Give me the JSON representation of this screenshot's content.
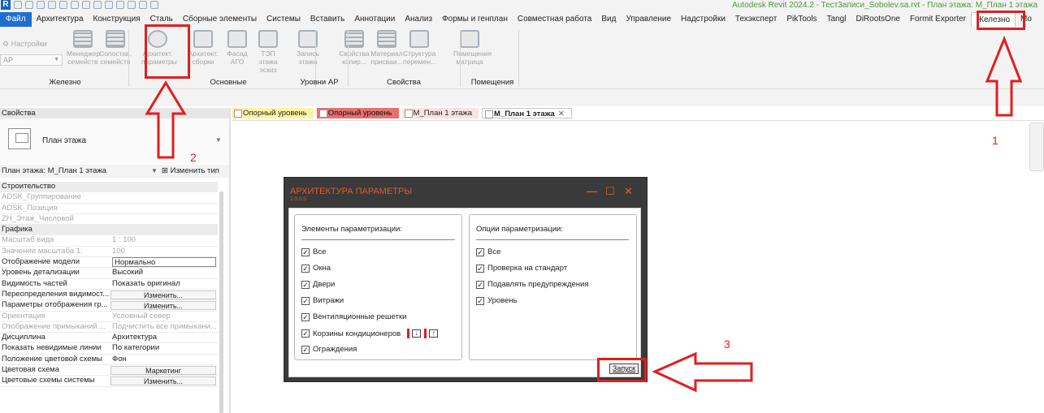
{
  "window": {
    "title": "Autodesk Revit 2024.2 - Тест3аписи_Sobolev.sa.rvt - План этажа: М_План 1 этажа",
    "logo": "R"
  },
  "menu": {
    "file": "Файл",
    "items": [
      "Архитектура",
      "Конструкция",
      "Сталь",
      "Сборные элементы",
      "Системы",
      "Вставить",
      "Аннотации",
      "Анализ",
      "Формы и генплан",
      "Совместная работа",
      "Вид",
      "Управление",
      "Надстройки",
      "Техэксперт",
      "PikTools",
      "Tangl",
      "DiRootsOne",
      "Formit Exporter"
    ],
    "active": "Железно",
    "overflow": "Mo"
  },
  "ribbon": {
    "settings_label": "Настройки",
    "combo_value": "АР",
    "buttons": [
      {
        "l1": "Менеджер",
        "l2": "семейств"
      },
      {
        "l1": "Сопостав.",
        "l2": "семейств"
      },
      {
        "l1": "Архитект.",
        "l2": "параметры"
      },
      {
        "l1": "Архитект.",
        "l2": "сборки"
      },
      {
        "l1": "Фасад",
        "l2": "АГО"
      },
      {
        "l1": "ТЭП этажа",
        "l2": "эскиз"
      },
      {
        "l1": "Запись",
        "l2": "этажа"
      },
      {
        "l1": "Свойства",
        "l2": "копир..."
      },
      {
        "l1": "Материал",
        "l2": "присваи..."
      },
      {
        "l1": "Структура",
        "l2": "перемен..."
      },
      {
        "l1": "Помещения",
        "l2": "матрица"
      }
    ],
    "panels": [
      "Железно",
      "Основные",
      "Уровни АР",
      "Свойства",
      "Помещения"
    ]
  },
  "properties": {
    "header": "Свойства",
    "type_name": "План этажа",
    "instance_label": "План этажа: М_План 1 этажа",
    "edit_type": "Изменить тип",
    "rows": [
      {
        "kind": "cat",
        "name": "Строительство"
      },
      {
        "kind": "row",
        "name": "ADSK_Группирование",
        "value": "",
        "gray": true
      },
      {
        "kind": "row",
        "name": "ADSK_Позиция",
        "value": "",
        "gray": true
      },
      {
        "kind": "row",
        "name": "ZH_Этаж_Числовой",
        "value": "",
        "gray": true
      },
      {
        "kind": "cat",
        "name": "Графика"
      },
      {
        "kind": "row",
        "name": "Масштаб вида",
        "value": "1 : 100",
        "gray": true
      },
      {
        "kind": "row",
        "name": "Значение масштаба    1:",
        "value": "100",
        "gray": true
      },
      {
        "kind": "box",
        "name": "Отображение модели",
        "value": "Нормально"
      },
      {
        "kind": "row",
        "name": "Уровень детализации",
        "value": "Высокий"
      },
      {
        "kind": "row",
        "name": "Видимость частей",
        "value": "Показать оригинал"
      },
      {
        "kind": "btn",
        "name": "Переопределения видимост...",
        "value": "Изменить..."
      },
      {
        "kind": "btn",
        "name": "Параметры отображения гр...",
        "value": "Изменить..."
      },
      {
        "kind": "row",
        "name": "Ориентация",
        "value": "Условный север",
        "gray": true
      },
      {
        "kind": "row",
        "name": "Отображение примыканий ...",
        "value": "Подчистить все примыкани...",
        "gray": true
      },
      {
        "kind": "row",
        "name": "Дисциплина",
        "value": "Архитектура"
      },
      {
        "kind": "row",
        "name": "Показать невидимые линии",
        "value": "По категории"
      },
      {
        "kind": "row",
        "name": "Положение цветовой схемы",
        "value": "Фон"
      },
      {
        "kind": "btn",
        "name": "Цветовая схема",
        "value": "Маркетинг"
      },
      {
        "kind": "btn",
        "name": "Цветовые схемы системы",
        "value": "Изменить..."
      }
    ]
  },
  "tabs": [
    {
      "label": "Опорный уровень"
    },
    {
      "label": "Опорный уровень"
    },
    {
      "label": "М_План 1 этажа"
    },
    {
      "label": "М_План 1 этажа",
      "close": "✕"
    }
  ],
  "dialog": {
    "title": "АРХИТЕКТУРА ПАРАМЕТРЫ",
    "version": "1.0.0.5",
    "controls": {
      "minimize": "—",
      "maximize": "☐",
      "close": "✕"
    },
    "left": {
      "title": "Элементы параметризации:",
      "items": [
        "Все",
        "Окна",
        "Двери",
        "Витражи",
        "Вентиляционные решетки",
        "Корзины кондиционеров",
        "Ограждения"
      ]
    },
    "right": {
      "title": "Опции параметризации:",
      "items": [
        "Все",
        "Проверка на стандарт",
        "Подавлять предупреждения",
        "Уровень"
      ]
    },
    "run": "Запуск",
    "check_mark": "✓"
  },
  "annotations": {
    "n1": "1",
    "n2": "2",
    "n3": "3",
    "color": "#e01e1e"
  }
}
